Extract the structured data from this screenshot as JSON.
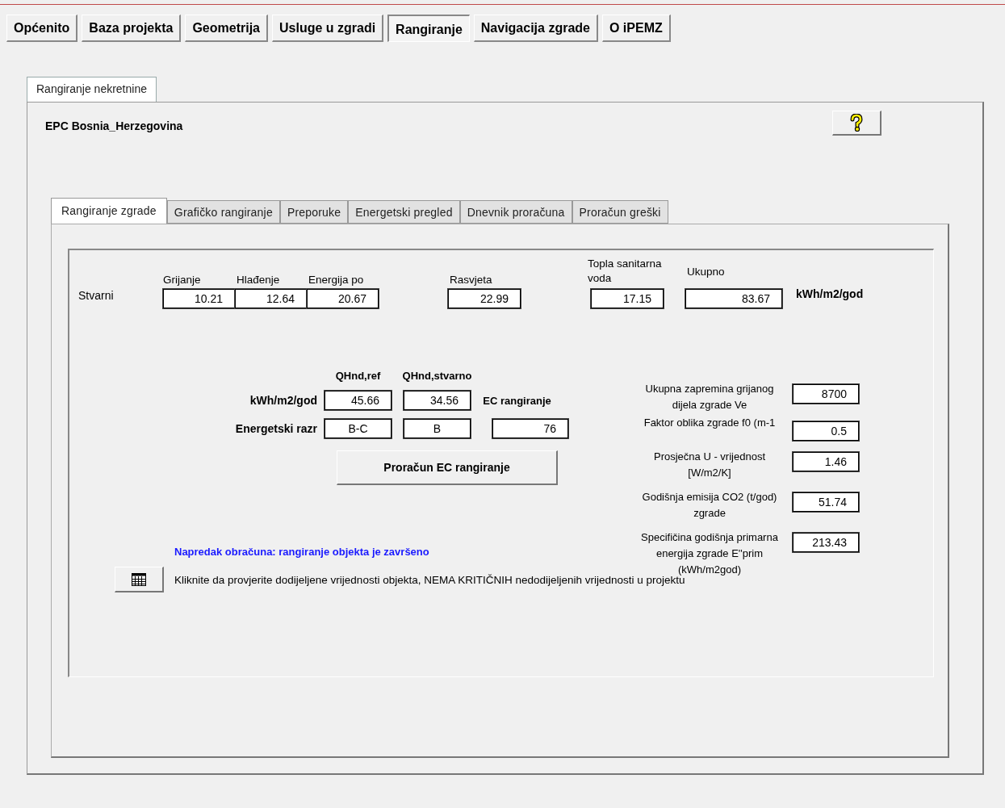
{
  "main_tabs": [
    {
      "label": "Općenito",
      "selected": false
    },
    {
      "label": "Baza projekta",
      "selected": false
    },
    {
      "label": "Geometrija",
      "selected": false
    },
    {
      "label": "Usluge u zgradi",
      "selected": false
    },
    {
      "label": "Rangiranje",
      "selected": true
    },
    {
      "label": "Navigacija zgrade",
      "selected": false
    },
    {
      "label": "O iPEMZ",
      "selected": false
    }
  ],
  "page_tabs": [
    {
      "label": "Rangiranje nekretnine",
      "selected": true
    }
  ],
  "page_title": "EPC Bosnia_Herzegovina",
  "sub_tabs": [
    {
      "label": "Rangiranje zgrade",
      "selected": true
    },
    {
      "label": "Grafičko rangiranje",
      "selected": false
    },
    {
      "label": "Preporuke",
      "selected": false
    },
    {
      "label": "Energetski pregled",
      "selected": false
    },
    {
      "label": "Dnevnik proračuna",
      "selected": false
    },
    {
      "label": "Proračun greški",
      "selected": false
    }
  ],
  "actual": {
    "row_label": "Stvarni",
    "unit": "kWh/m2/god",
    "columns": [
      {
        "label": "Grijanje",
        "value": "10.21"
      },
      {
        "label": "Hlađenje",
        "value": "12.64"
      },
      {
        "label": "Energija po",
        "value": "20.67"
      },
      {
        "label": "Rasvjeta",
        "value": "22.99"
      },
      {
        "label": "Topla sanitarna voda",
        "value": "17.15"
      },
      {
        "label": "Ukupno",
        "value": "83.67"
      }
    ]
  },
  "ranking": {
    "headers": [
      "QHnd,ref",
      "QHnd,stvarno"
    ],
    "rows": [
      {
        "label": "kWh/m2/god",
        "values": [
          "45.66",
          "34.56"
        ],
        "extra_label": "EC rangiranje"
      },
      {
        "label": "Energetski razr",
        "values": [
          "B-C",
          "B",
          "76"
        ]
      }
    ],
    "button": "Proračun EC rangiranje"
  },
  "building": [
    {
      "label": "Ukupna zapremina grijanog dijela zgrade Ve",
      "value": "8700"
    },
    {
      "label": "Faktor oblika zgrade f0 (m-1",
      "value": "0.5"
    },
    {
      "label": "Prosječna U - vrijednost [W/m2/K]",
      "value": "1.46"
    },
    {
      "label": "Godišnja emisija CO2 (t/god) zgrade",
      "value": "51.74"
    },
    {
      "label": "Specifičina godišnja primarna energija zgrade E''prim (kWh/m2god)",
      "value": "213.43"
    }
  ],
  "progress": "Napredak obračuna: rangiranje objekta je završeno",
  "check_text": "Kliknite da provjerite dodijeljene vrijednosti objekta, NEMA KRITIČNIH nedodijeljenih vrijednosti u projektu"
}
